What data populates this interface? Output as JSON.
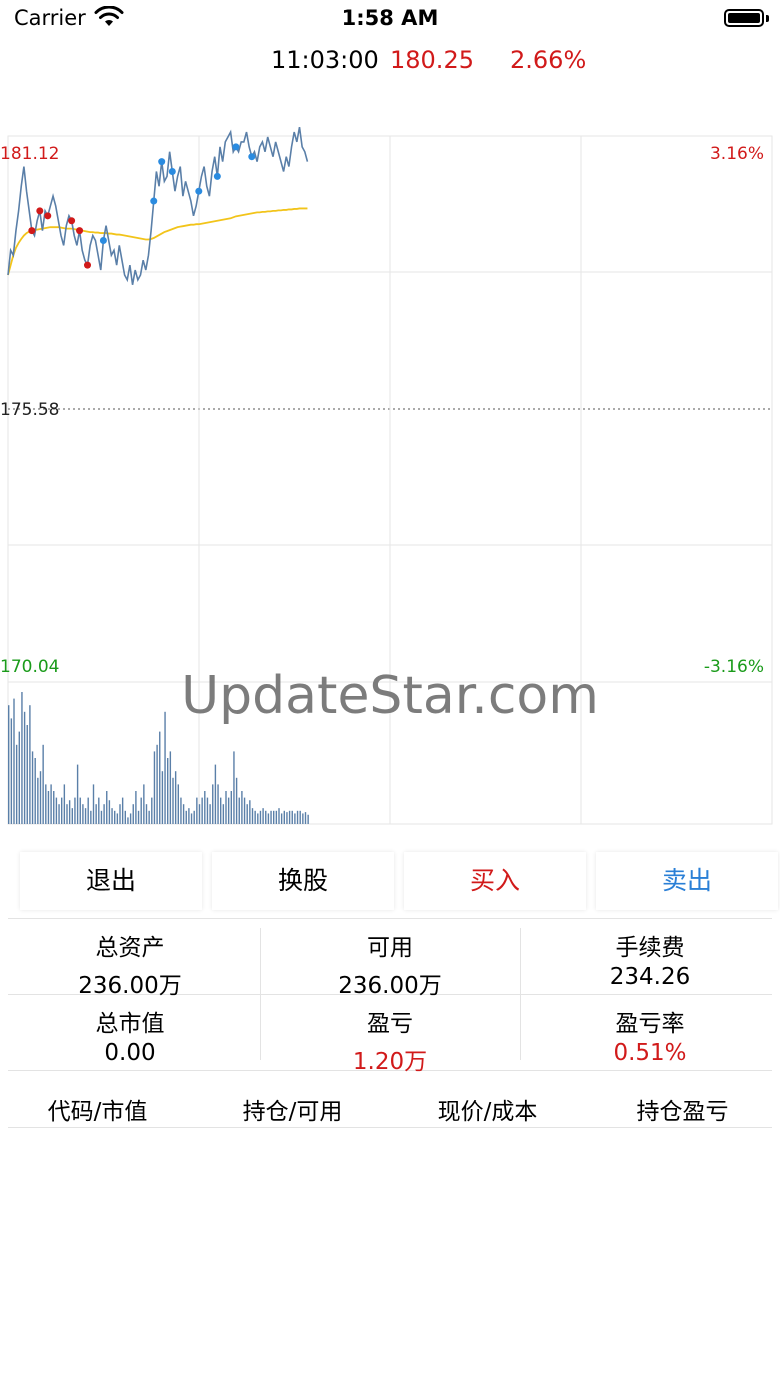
{
  "status_bar": {
    "carrier": "Carrier",
    "time": "1:58 AM"
  },
  "quote": {
    "time": "11:03:00",
    "price": "180.25",
    "change_pct": "2.66%"
  },
  "chart_data": {
    "type": "line",
    "axis_labels": {
      "high_price": "181.12",
      "mid_price": "175.58",
      "low_price": "170.04",
      "high_pct": "3.16%",
      "low_pct": "-3.16%"
    },
    "ylim": [
      170.04,
      181.12
    ],
    "series": [],
    "price": [
      178.3,
      178.8,
      178.7,
      179.2,
      179.6,
      180.1,
      180.5,
      180.0,
      179.6,
      179.2,
      179.1,
      179.4,
      179.6,
      179.2,
      179.6,
      179.5,
      179.7,
      179.9,
      179.7,
      179.4,
      179.1,
      178.9,
      179.3,
      179.5,
      179.4,
      179.1,
      178.9,
      179.2,
      178.8,
      178.6,
      178.5,
      178.9,
      179.1,
      179.0,
      178.7,
      178.4,
      179.0,
      179.3,
      179.0,
      178.7,
      178.8,
      178.5,
      178.9,
      178.6,
      178.3,
      178.2,
      178.5,
      178.1,
      178.4,
      178.2,
      178.3,
      178.6,
      178.4,
      178.7,
      179.2,
      179.8,
      180.4,
      180.1,
      180.6,
      180.2,
      180.3,
      180.8,
      180.4,
      180.0,
      180.3,
      180.5,
      179.9,
      180.2,
      180.0,
      179.8,
      179.5,
      179.7,
      180.0,
      180.3,
      180.5,
      180.1,
      179.9,
      180.4,
      180.7,
      180.3,
      180.9,
      180.6,
      181.0,
      181.1,
      181.2,
      180.8,
      180.9,
      180.8,
      181.0,
      181.0,
      181.2,
      180.9,
      180.7,
      180.8,
      180.6,
      180.9,
      181.0,
      180.8,
      181.1,
      180.9,
      180.7,
      181.0,
      180.8,
      180.6,
      180.4,
      180.7,
      180.5,
      180.9,
      181.2,
      181.0,
      181.3,
      180.9,
      180.8,
      180.6
    ],
    "avg_price": [
      178.3,
      178.5,
      178.7,
      178.85,
      178.95,
      179.03,
      179.1,
      179.15,
      179.18,
      179.2,
      179.21,
      179.22,
      179.23,
      179.24,
      179.25,
      179.26,
      179.27,
      179.27,
      179.27,
      179.27,
      179.26,
      179.25,
      179.24,
      179.24,
      179.24,
      179.23,
      179.22,
      179.21,
      179.2,
      179.19,
      179.18,
      179.17,
      179.17,
      179.16,
      179.16,
      179.15,
      179.15,
      179.15,
      179.14,
      179.14,
      179.13,
      179.12,
      179.12,
      179.11,
      179.1,
      179.09,
      179.08,
      179.07,
      179.06,
      179.05,
      179.04,
      179.03,
      179.02,
      179.02,
      179.03,
      179.05,
      179.08,
      179.11,
      179.14,
      179.17,
      179.19,
      179.21,
      179.23,
      179.25,
      179.27,
      179.28,
      179.29,
      179.3,
      179.31,
      179.32,
      179.32,
      179.33,
      179.33,
      179.34,
      179.35,
      179.36,
      179.37,
      179.38,
      179.39,
      179.4,
      179.41,
      179.42,
      179.43,
      179.44,
      179.45,
      179.47,
      179.49,
      179.5,
      179.51,
      179.52,
      179.53,
      179.54,
      179.55,
      179.56,
      179.57,
      179.57,
      179.58,
      179.58,
      179.59,
      179.59,
      179.6,
      179.6,
      179.61,
      179.61,
      179.62,
      179.62,
      179.63,
      179.63,
      179.64,
      179.64,
      179.65,
      179.65,
      179.65,
      179.65
    ],
    "buy_marker_indices": [
      9,
      12,
      15,
      24,
      27,
      30
    ],
    "sell_marker_indices": [
      36,
      55,
      58,
      62,
      72,
      79,
      86,
      92
    ],
    "volume": [
      0.9,
      0.8,
      0.95,
      0.6,
      0.7,
      1.0,
      0.85,
      0.75,
      0.9,
      0.55,
      0.5,
      0.35,
      0.4,
      0.6,
      0.3,
      0.25,
      0.3,
      0.25,
      0.2,
      0.15,
      0.2,
      0.3,
      0.15,
      0.18,
      0.12,
      0.2,
      0.45,
      0.2,
      0.15,
      0.12,
      0.2,
      0.1,
      0.3,
      0.15,
      0.2,
      0.1,
      0.15,
      0.25,
      0.18,
      0.12,
      0.1,
      0.08,
      0.15,
      0.2,
      0.1,
      0.05,
      0.08,
      0.15,
      0.25,
      0.1,
      0.2,
      0.3,
      0.15,
      0.1,
      0.2,
      0.55,
      0.6,
      0.7,
      0.4,
      0.85,
      0.5,
      0.55,
      0.35,
      0.4,
      0.3,
      0.2,
      0.15,
      0.1,
      0.12,
      0.08,
      0.1,
      0.2,
      0.15,
      0.2,
      0.25,
      0.2,
      0.15,
      0.3,
      0.45,
      0.3,
      0.2,
      0.15,
      0.25,
      0.2,
      0.25,
      0.55,
      0.35,
      0.2,
      0.25,
      0.2,
      0.15,
      0.18,
      0.12,
      0.1,
      0.08,
      0.1,
      0.12,
      0.1,
      0.08,
      0.1,
      0.1,
      0.1,
      0.12,
      0.08,
      0.1,
      0.09,
      0.1,
      0.1,
      0.08,
      0.1,
      0.1,
      0.08,
      0.09,
      0.07
    ],
    "colors": {
      "price_line": "#5a7fa8",
      "avg_line": "#f2c41a",
      "buy_marker": "#d11a1a",
      "sell_marker": "#2a8be0",
      "volume_bar": "#5a7fa8",
      "grid": "#e6e6e6"
    }
  },
  "watermark": "UpdateStar.com",
  "actions": {
    "exit": "退出",
    "switch_stock": "换股",
    "buy": "买入",
    "sell": "卖出"
  },
  "account": {
    "total_assets_label": "总资产",
    "total_assets_value": "236.00万",
    "available_label": "可用",
    "available_value": "236.00万",
    "fee_label": "手续费",
    "fee_value": "234.26",
    "market_value_label": "总市值",
    "market_value_value": "0.00",
    "pnl_label": "盈亏",
    "pnl_value": "1.20万",
    "pnl_rate_label": "盈亏率",
    "pnl_rate_value": "0.51%"
  },
  "positions_header": {
    "code_value": "代码/市值",
    "hold_available": "持仓/可用",
    "price_cost": "现价/成本",
    "hold_pnl": "持仓盈亏"
  }
}
